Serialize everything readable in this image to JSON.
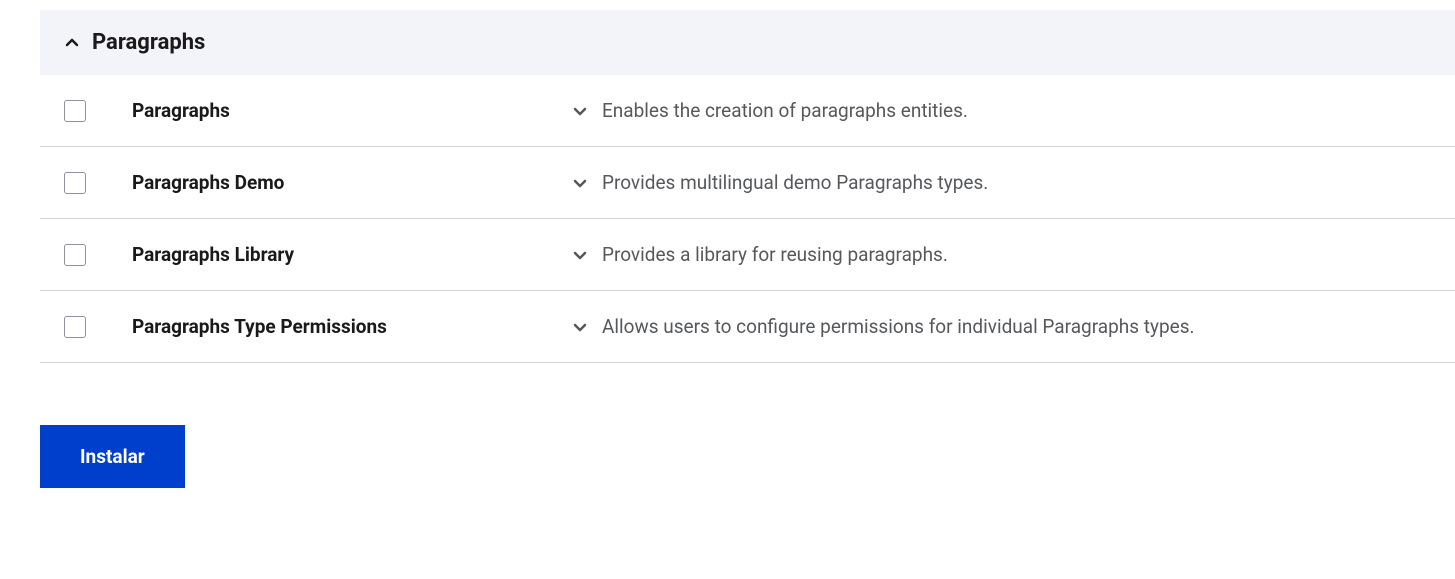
{
  "section": {
    "title": "Paragraphs"
  },
  "modules": [
    {
      "name": "Paragraphs",
      "description": "Enables the creation of paragraphs entities."
    },
    {
      "name": "Paragraphs Demo",
      "description": "Provides multilingual demo Paragraphs types."
    },
    {
      "name": "Paragraphs Library",
      "description": "Provides a library for reusing paragraphs."
    },
    {
      "name": "Paragraphs Type Permissions",
      "description": "Allows users to configure permissions for individual Paragraphs types."
    }
  ],
  "actions": {
    "install_label": "Instalar"
  }
}
